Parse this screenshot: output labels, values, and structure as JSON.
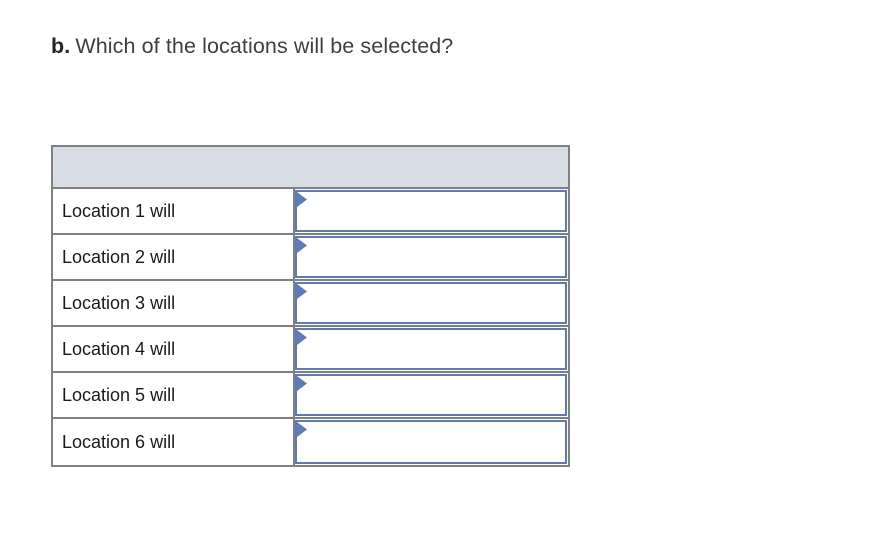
{
  "page": {
    "background_color": "#ffffff"
  },
  "question": {
    "label": "b.",
    "text": "Which of the locations will be selected?"
  },
  "table": {
    "header_band_label": "",
    "header_band_color": "#d8dce5",
    "border_color": "#808080",
    "rows": [
      {
        "label": "Location 1 will",
        "selected_value": "",
        "marker": "dropdown-triangle-icon"
      },
      {
        "label": "Location 2 will",
        "selected_value": "",
        "marker": "dropdown-triangle-icon"
      },
      {
        "label": "Location 3 will",
        "selected_value": "",
        "marker": "dropdown-triangle-icon"
      },
      {
        "label": "Location 4 will",
        "selected_value": "",
        "marker": "dropdown-triangle-icon"
      },
      {
        "label": "Location 5 will",
        "selected_value": "",
        "marker": "dropdown-triangle-icon"
      },
      {
        "label": "Location 6 will",
        "selected_value": "",
        "marker": "dropdown-triangle-icon"
      }
    ],
    "dropdown": {
      "border_color": "#5b7cb8",
      "marker_color": "#5b7cb8",
      "background_color": "#ffffff"
    }
  }
}
